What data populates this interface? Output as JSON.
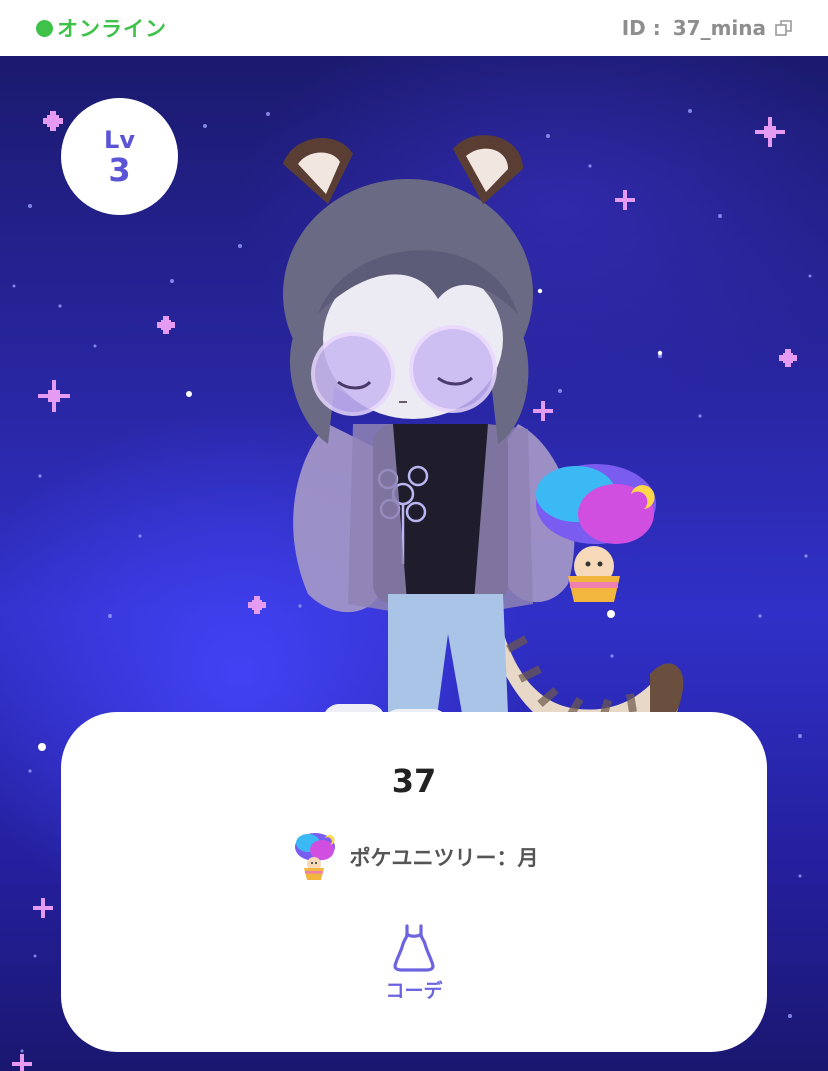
{
  "header": {
    "status_text": "オンライン",
    "status_color": "#3ec24a",
    "id_label": "ID :",
    "id_value": "37_mina",
    "copy_icon": "copy-icon"
  },
  "level": {
    "label": "Lv",
    "value": "3",
    "color": "#5b54d6"
  },
  "card": {
    "name": "37",
    "pet_icon": "cloud-tree-pet-icon",
    "pet_text": "ポケユニツリー：月",
    "button_icon": "dress-icon",
    "button_label": "コーデ",
    "accent": "#6c63e0"
  },
  "colors": {
    "sparkle": "#e59bf2"
  }
}
